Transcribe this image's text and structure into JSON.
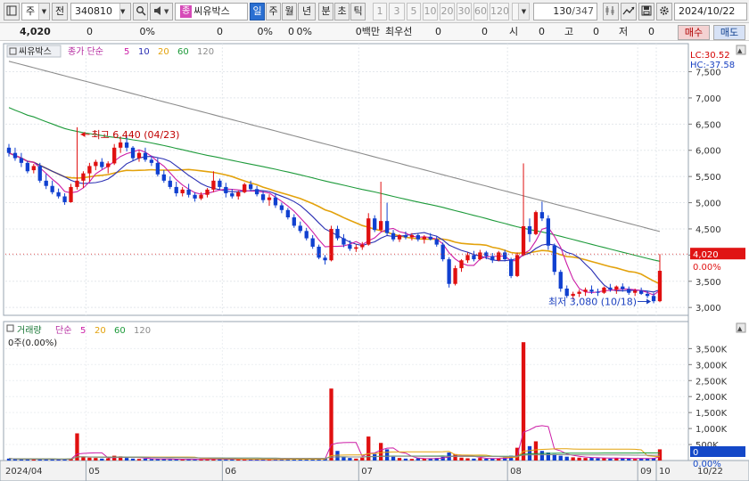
{
  "toolbar": {
    "type_label": "주",
    "prefix": "전",
    "code": "340810",
    "stock_tag": "종",
    "stock_name": "씨유박스",
    "periods": [
      "일",
      "주",
      "월",
      "년",
      "분",
      "초",
      "틱"
    ],
    "active_period": "일",
    "intervals": [
      "1",
      "3",
      "5",
      "10",
      "20",
      "30",
      "60",
      "120"
    ],
    "count": "130",
    "total": "/347",
    "date": "2024/10/22"
  },
  "quote": {
    "price": "4,020",
    "change": "0",
    "change_pct": "0%",
    "volume": "0",
    "volume_pct": "0%",
    "amount": "0",
    "amount_pct": "0%",
    "amount_unit": "0백만",
    "priority_label": "최우선",
    "priority_ask": "0",
    "priority_bid": "0",
    "open_label": "시",
    "open": "0",
    "high_label": "고",
    "high": "0",
    "low_label": "저",
    "low": "0",
    "buy_label": "매수",
    "sell_label": "매도"
  },
  "colors": {
    "up": "#e01010",
    "down": "#1040d0",
    "ma5": "#cc1ca6",
    "ma10": "#2a2fb3",
    "ma20": "#e3a20c",
    "ma60": "#1d9a3a",
    "ma120": "#8c8c8c"
  },
  "price_panel": {
    "title_tag": "씨유박스",
    "legend_prefix": "종가 단순",
    "ma_periods": [
      "5",
      "10",
      "20",
      "60",
      "120"
    ],
    "lc": "LC:30.52",
    "hc": "HC:-37.58",
    "current_label": "4,020",
    "current_pct": "0.00%",
    "y_ticks": [
      "7,500",
      "7,000",
      "6,500",
      "6,000",
      "5,500",
      "5,000",
      "4,500",
      "4,000",
      "3,500",
      "3,000"
    ],
    "high_note": "최고 6,440 (04/23)",
    "low_note": "최저 3,080 (10/18)"
  },
  "volume_panel": {
    "title": "거래량",
    "legend_prefix": "단순",
    "ma_periods": [
      "5",
      "20",
      "60",
      "120"
    ],
    "sub_label": "0주(0.00%)",
    "y_ticks": [
      "3,500K",
      "3,000K",
      "2,500K",
      "2,000K",
      "1,500K",
      "1,000K",
      "500K"
    ],
    "current_label": "0",
    "current_pct": "0.00%"
  },
  "x_axis": {
    "labels": [
      "2024/04",
      "05",
      "06",
      "07",
      "08",
      "09",
      "10"
    ],
    "right_label": "10/22"
  },
  "chart_data": [
    {
      "type": "candlestick",
      "ylim": [
        2850,
        7900
      ],
      "y_ticks": [
        7500,
        7000,
        6500,
        6000,
        5500,
        5000,
        4500,
        4000,
        3500,
        3000
      ],
      "ohlc": [
        [
          6050,
          6120,
          5880,
          5950
        ],
        [
          5950,
          6050,
          5800,
          5850
        ],
        [
          5850,
          5950,
          5680,
          5760
        ],
        [
          5760,
          5800,
          5560,
          5600
        ],
        [
          5620,
          5740,
          5560,
          5700
        ],
        [
          5700,
          5760,
          5380,
          5420
        ],
        [
          5420,
          5550,
          5260,
          5320
        ],
        [
          5320,
          5420,
          5160,
          5200
        ],
        [
          5200,
          5270,
          5080,
          5120
        ],
        [
          5120,
          5180,
          4960,
          5010
        ],
        [
          5010,
          5360,
          5000,
          5300
        ],
        [
          5300,
          6440,
          5250,
          5420
        ],
        [
          5420,
          5600,
          5280,
          5560
        ],
        [
          5560,
          5760,
          5400,
          5700
        ],
        [
          5700,
          5820,
          5620,
          5780
        ],
        [
          5780,
          5850,
          5640,
          5680
        ],
        [
          5680,
          5790,
          5560,
          5750
        ],
        [
          5750,
          6120,
          5720,
          6050
        ],
        [
          6050,
          6220,
          5950,
          6150
        ],
        [
          6150,
          6260,
          5980,
          6050
        ],
        [
          6050,
          6080,
          5800,
          5850
        ],
        [
          5850,
          6000,
          5780,
          5950
        ],
        [
          5950,
          6050,
          5780,
          5820
        ],
        [
          5820,
          5900,
          5700,
          5760
        ],
        [
          5760,
          5850,
          5500,
          5540
        ],
        [
          5540,
          5620,
          5380,
          5420
        ],
        [
          5420,
          5500,
          5260,
          5300
        ],
        [
          5300,
          5400,
          5120,
          5180
        ],
        [
          5180,
          5300,
          5120,
          5250
        ],
        [
          5250,
          5360,
          5100,
          5150
        ],
        [
          5150,
          5200,
          5020,
          5080
        ],
        [
          5080,
          5200,
          5050,
          5150
        ],
        [
          5150,
          5280,
          5100,
          5250
        ],
        [
          5250,
          5600,
          5200,
          5420
        ],
        [
          5420,
          5460,
          5250,
          5300
        ],
        [
          5300,
          5380,
          5100,
          5180
        ],
        [
          5180,
          5260,
          5080,
          5120
        ],
        [
          5120,
          5230,
          5060,
          5200
        ],
        [
          5200,
          5380,
          5180,
          5350
        ],
        [
          5350,
          5420,
          5220,
          5260
        ],
        [
          5260,
          5320,
          5120,
          5160
        ],
        [
          5160,
          5220,
          5000,
          5050
        ],
        [
          5050,
          5160,
          4940,
          5100
        ],
        [
          5100,
          5180,
          4900,
          4950
        ],
        [
          4950,
          5000,
          4800,
          4860
        ],
        [
          4860,
          4900,
          4680,
          4720
        ],
        [
          4720,
          4780,
          4520,
          4560
        ],
        [
          4560,
          4640,
          4420,
          4460
        ],
        [
          4460,
          4520,
          4280,
          4320
        ],
        [
          4320,
          4380,
          4120,
          4160
        ],
        [
          4160,
          4200,
          3920,
          3950
        ],
        [
          3950,
          4000,
          3820,
          3900
        ],
        [
          3900,
          4560,
          3880,
          4500
        ],
        [
          4500,
          4560,
          4280,
          4320
        ],
        [
          4320,
          4400,
          4150,
          4200
        ],
        [
          4200,
          4280,
          4080,
          4120
        ],
        [
          4120,
          4200,
          4060,
          4150
        ],
        [
          4150,
          4250,
          4100,
          4200
        ],
        [
          4200,
          4800,
          4180,
          4700
        ],
        [
          4700,
          4760,
          4440,
          4480
        ],
        [
          4480,
          5400,
          4450,
          4650
        ],
        [
          4650,
          5000,
          4380,
          4420
        ],
        [
          4420,
          4480,
          4260,
          4300
        ],
        [
          4300,
          4400,
          4250,
          4380
        ],
        [
          4380,
          4450,
          4300,
          4340
        ],
        [
          4340,
          4420,
          4280,
          4380
        ],
        [
          4380,
          4420,
          4260,
          4300
        ],
        [
          4300,
          4380,
          4220,
          4350
        ],
        [
          4350,
          4420,
          4280,
          4300
        ],
        [
          4300,
          4360,
          4160,
          4200
        ],
        [
          4200,
          4240,
          3880,
          3920
        ],
        [
          3920,
          3960,
          3380,
          3450
        ],
        [
          3450,
          3800,
          3420,
          3750
        ],
        [
          3750,
          3920,
          3680,
          3900
        ],
        [
          3900,
          4050,
          3850,
          4000
        ],
        [
          4000,
          4080,
          3880,
          3920
        ],
        [
          3920,
          4100,
          3900,
          4050
        ],
        [
          4050,
          4080,
          3920,
          3980
        ],
        [
          3980,
          4040,
          3850,
          3900
        ],
        [
          3900,
          4080,
          3880,
          4050
        ],
        [
          4050,
          4100,
          3880,
          3920
        ],
        [
          3920,
          3950,
          3560,
          3600
        ],
        [
          3600,
          4050,
          3580,
          4000
        ],
        [
          4000,
          5750,
          3980,
          4550
        ],
        [
          4550,
          4700,
          4250,
          4400
        ],
        [
          4400,
          4850,
          4380,
          4820
        ],
        [
          4820,
          5020,
          4650,
          4700
        ],
        [
          4700,
          4760,
          4100,
          4180
        ],
        [
          4180,
          4220,
          3620,
          3680
        ],
        [
          3680,
          3720,
          3300,
          3360
        ],
        [
          3360,
          3420,
          3180,
          3220
        ],
        [
          3220,
          3300,
          3150,
          3260
        ],
        [
          3260,
          3340,
          3200,
          3300
        ],
        [
          3300,
          3380,
          3220,
          3340
        ],
        [
          3340,
          3420,
          3260,
          3300
        ],
        [
          3300,
          3360,
          3220,
          3280
        ],
        [
          3280,
          3400,
          3260,
          3380
        ],
        [
          3380,
          3450,
          3300,
          3340
        ],
        [
          3340,
          3420,
          3260,
          3400
        ],
        [
          3400,
          3460,
          3300,
          3350
        ],
        [
          3350,
          3400,
          3240,
          3280
        ],
        [
          3280,
          3360,
          3220,
          3320
        ],
        [
          3320,
          3380,
          3240,
          3260
        ],
        [
          3260,
          3320,
          3180,
          3220
        ],
        [
          3220,
          3280,
          3080,
          3120
        ],
        [
          3120,
          4020,
          3100,
          3700
        ]
      ],
      "volume_k": [
        60,
        45,
        40,
        55,
        35,
        50,
        40,
        45,
        30,
        50,
        60,
        850,
        120,
        90,
        80,
        60,
        70,
        150,
        130,
        80,
        60,
        50,
        60,
        45,
        40,
        50,
        35,
        40,
        30,
        45,
        40,
        35,
        50,
        55,
        40,
        35,
        30,
        45,
        40,
        30,
        35,
        40,
        30,
        45,
        40,
        50,
        55,
        40,
        45,
        50,
        60,
        70,
        2250,
        300,
        120,
        80,
        60,
        90,
        750,
        200,
        550,
        350,
        120,
        80,
        60,
        50,
        70,
        55,
        60,
        80,
        120,
        250,
        200,
        90,
        70,
        60,
        80,
        55,
        60,
        70,
        90,
        150,
        400,
        3700,
        450,
        600,
        300,
        250,
        200,
        150,
        120,
        100,
        90,
        80,
        90,
        70,
        80,
        60,
        70,
        80,
        60,
        50,
        70,
        60,
        80,
        350
      ],
      "volume_ylim": [
        0,
        3900
      ]
    }
  ]
}
